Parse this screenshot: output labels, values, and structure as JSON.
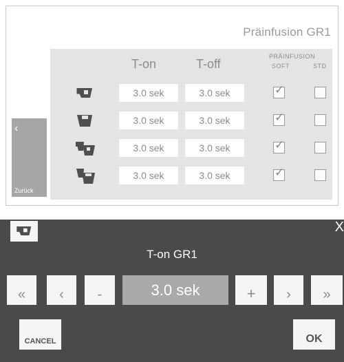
{
  "screen": {
    "title": "Präinfusion  GR1",
    "headers": {
      "t_on": "T-on",
      "t_off": "T-off",
      "preinfusion": "PRÄINFUSION",
      "soft": "SOFT",
      "std": "STD"
    },
    "rows": [
      {
        "icon": "single-cup-icon",
        "t_on": "3.0 sek",
        "t_off": "3.0 sek",
        "soft": true,
        "std": false
      },
      {
        "icon": "double-cup-icon",
        "t_on": "3.0 sek",
        "t_off": "3.0 sek",
        "soft": true,
        "std": false
      },
      {
        "icon": "single-cups-pair-icon",
        "t_on": "3.0 sek",
        "t_off": "3.0 sek",
        "soft": true,
        "std": false
      },
      {
        "icon": "double-cups-pair-icon",
        "t_on": "3.0 sek",
        "t_off": "3.0 sek",
        "soft": true,
        "std": false
      }
    ],
    "back": {
      "chevron": "‹",
      "label": "Zurück"
    }
  },
  "dialog": {
    "icon": "single-cup-icon",
    "close": "X",
    "title": "T-on  GR1",
    "value": "3.0 sek",
    "buttons": {
      "fast_back": "«",
      "back": "‹",
      "minus": "-",
      "plus": "+",
      "forward": "›",
      "fast_forward": "»"
    },
    "cancel": "CANCEL",
    "ok": "OK"
  },
  "colors": {
    "panel_bg": "#e4e4e4",
    "dialog_bg": "#4a4a4a",
    "value_display": "#a9a9a9",
    "back_button": "#a6a6a6",
    "icon_dark": "#4f4f4f"
  }
}
